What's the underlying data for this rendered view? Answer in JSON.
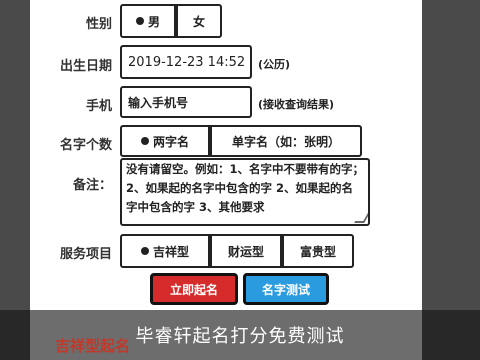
{
  "form": {
    "gender": {
      "label": "性别",
      "options": [
        "男",
        "女"
      ],
      "selected": "男"
    },
    "birth": {
      "label": "出生日期",
      "value": "2019-12-23 14:52",
      "note": "(公历)"
    },
    "phone": {
      "label": "手机",
      "placeholder": "输入手机号",
      "note": "(接收查询结果)"
    },
    "name_type": {
      "label": "名字个数",
      "options": [
        "两字名",
        "单字名（如：张明）"
      ],
      "selected": "两字名"
    },
    "remark": {
      "label": "备注：",
      "value": "没有请留空。例如：1、名字中不要带有的字；2、如果起的名字中包含的字 2、如果起的名字中包含的字 3、其他要求"
    },
    "service": {
      "label": "服务项目",
      "options": [
        "吉祥型",
        "财运型",
        "富贵型"
      ],
      "selected": "吉祥型"
    },
    "buttons": {
      "submit": "立即起名",
      "test": "名字测试"
    }
  },
  "banner": {
    "text": "毕睿轩起名打分免费测试"
  },
  "section": {
    "title": "吉祥型起名"
  },
  "colors": {
    "red_button": "#d62b2b",
    "blue_button": "#2b9be0",
    "section_title": "#c0392b"
  }
}
